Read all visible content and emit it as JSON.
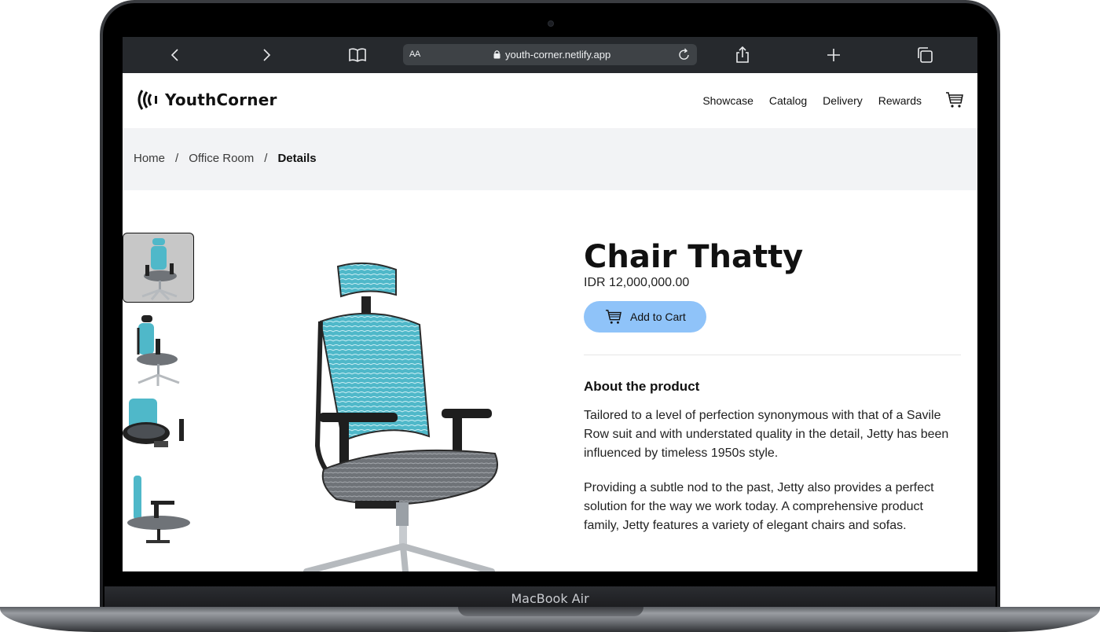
{
  "device": {
    "label": "MacBook Air"
  },
  "browser": {
    "text_size_label": "AA",
    "url": "youth-corner.netlify.app"
  },
  "site": {
    "brand": "YouthCorner",
    "nav": [
      "Showcase",
      "Catalog",
      "Delivery",
      "Rewards"
    ]
  },
  "breadcrumb": {
    "items": [
      "Home",
      "Office Room"
    ],
    "separator": "/",
    "current": "Details"
  },
  "product": {
    "name": "Chair Thatty",
    "price": "IDR 12,000,000.00",
    "add_to_cart_label": "Add to Cart",
    "about_title": "About the product",
    "description": [
      "Tailored to a level of perfection synonymous with that of a Savile Row suit and with understated quality in the detail, Jetty has been influenced by timeless 1950s style.",
      "Providing a subtle nod to the past, Jetty also provides a perfect solution for the way we work today. A comprehensive product family, Jetty features a variety of elegant chairs and sofas."
    ]
  },
  "colors": {
    "accent_button": "#8fc3f9",
    "mesh": "#4fb8c9",
    "seat": "#6f7378"
  }
}
